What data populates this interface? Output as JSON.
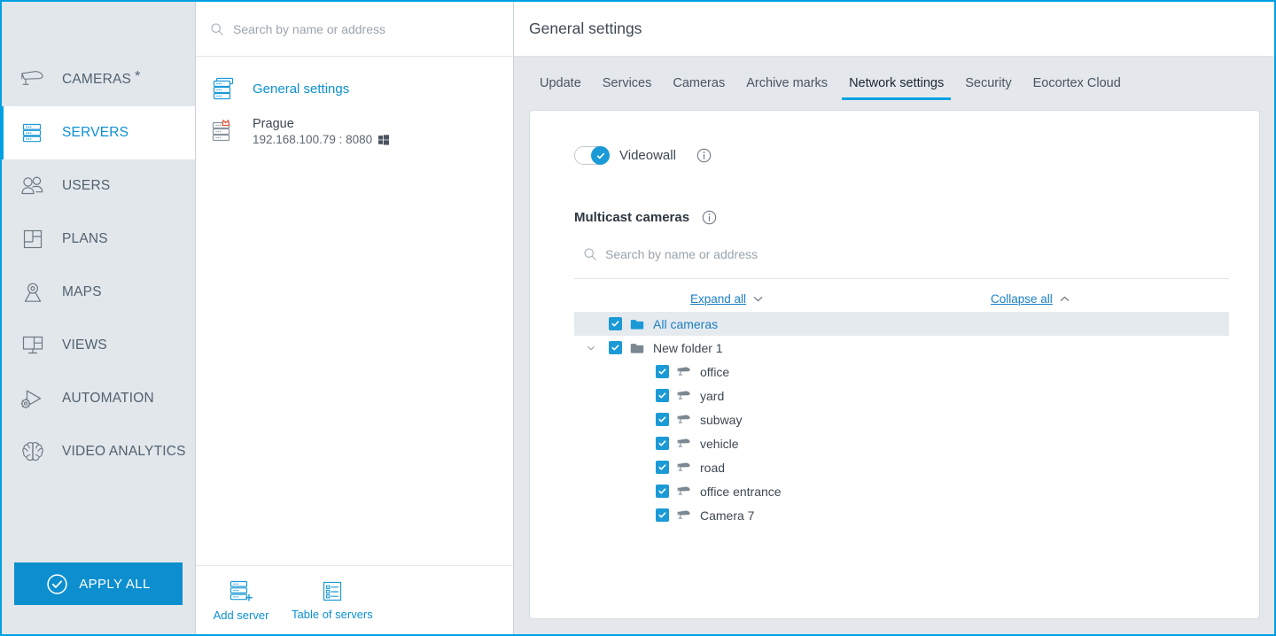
{
  "sidebar": {
    "items": [
      {
        "label": "CAMERAS",
        "icon": "camera-icon",
        "active": false,
        "star": "*"
      },
      {
        "label": "SERVERS",
        "icon": "server-icon",
        "active": true,
        "star": ""
      },
      {
        "label": "USERS",
        "icon": "users-icon",
        "active": false,
        "star": ""
      },
      {
        "label": "PLANS",
        "icon": "plans-icon",
        "active": false,
        "star": ""
      },
      {
        "label": "MAPS",
        "icon": "map-pin-icon",
        "active": false,
        "star": ""
      },
      {
        "label": "VIEWS",
        "icon": "views-grid-icon",
        "active": false,
        "star": ""
      },
      {
        "label": "AUTOMATION",
        "icon": "automation-gear-play-icon",
        "active": false,
        "star": ""
      },
      {
        "label": "VIDEO ANALYTICS",
        "icon": "brain-icon",
        "active": false,
        "star": ""
      }
    ],
    "apply_all_label": "APPLY ALL",
    "apply_all_icon": "check-circle-icon"
  },
  "list_panel": {
    "search_placeholder": "Search by name or address",
    "search_value": "",
    "search_icon": "search-icon",
    "general_settings_label": "General settings",
    "general_settings_icon": "servers-stack-icon",
    "server": {
      "name": "Prague",
      "address": "192.168.100.79 : 8080",
      "icon": "server-crown-icon",
      "os_icon": "windows-icon"
    },
    "footer": [
      {
        "label": "Add server",
        "icon": "add-server-icon"
      },
      {
        "label": "Table of servers",
        "icon": "table-of-servers-icon"
      }
    ]
  },
  "main": {
    "title": "General settings",
    "tabs": [
      {
        "label": "Update",
        "active": false
      },
      {
        "label": "Services",
        "active": false
      },
      {
        "label": "Cameras",
        "active": false
      },
      {
        "label": "Archive marks",
        "active": false
      },
      {
        "label": "Network settings",
        "active": true
      },
      {
        "label": "Security",
        "active": false
      },
      {
        "label": "Eocortex Cloud",
        "active": false
      }
    ],
    "videowall": {
      "label": "Videowall",
      "checked": true,
      "info_icon": "info-icon",
      "toggle_icon": "check-icon"
    },
    "multicast": {
      "title": "Multicast cameras",
      "info_icon": "info-icon",
      "search_placeholder": "Search by name or address",
      "search_value": "",
      "search_icon": "search-icon",
      "expand_all_label": "Expand all",
      "expand_all_icon": "chevron-down-icon",
      "collapse_all_label": "Collapse all",
      "collapse_all_icon": "chevron-up-icon",
      "tree": [
        {
          "label": "All cameras",
          "type": "folder",
          "depth": 0,
          "checked": true,
          "selected": true,
          "expandable": false
        },
        {
          "label": "New folder 1",
          "type": "folder",
          "depth": 1,
          "checked": true,
          "selected": false,
          "expandable": true
        },
        {
          "label": "office",
          "type": "camera",
          "depth": 2,
          "checked": true,
          "selected": false,
          "expandable": false
        },
        {
          "label": "yard",
          "type": "camera",
          "depth": 2,
          "checked": true,
          "selected": false,
          "expandable": false
        },
        {
          "label": "subway",
          "type": "camera",
          "depth": 2,
          "checked": true,
          "selected": false,
          "expandable": false
        },
        {
          "label": "vehicle",
          "type": "camera",
          "depth": 2,
          "checked": true,
          "selected": false,
          "expandable": false
        },
        {
          "label": "road",
          "type": "camera",
          "depth": 2,
          "checked": true,
          "selected": false,
          "expandable": false
        },
        {
          "label": "office entrance",
          "type": "camera",
          "depth": 2,
          "checked": true,
          "selected": false,
          "expandable": false
        },
        {
          "label": "Camera 7",
          "type": "camera",
          "depth": 2,
          "checked": true,
          "selected": false,
          "expandable": false
        }
      ]
    }
  },
  "colors": {
    "accent": "#00a0e3",
    "accent_dark": "#0c91d4",
    "link": "#1b7fc4",
    "panel_bg": "#e2e7ec",
    "content_bg": "#e4e8ed",
    "text": "#3d4852",
    "muted": "#9aa4ad",
    "crown": "#e8553f"
  }
}
